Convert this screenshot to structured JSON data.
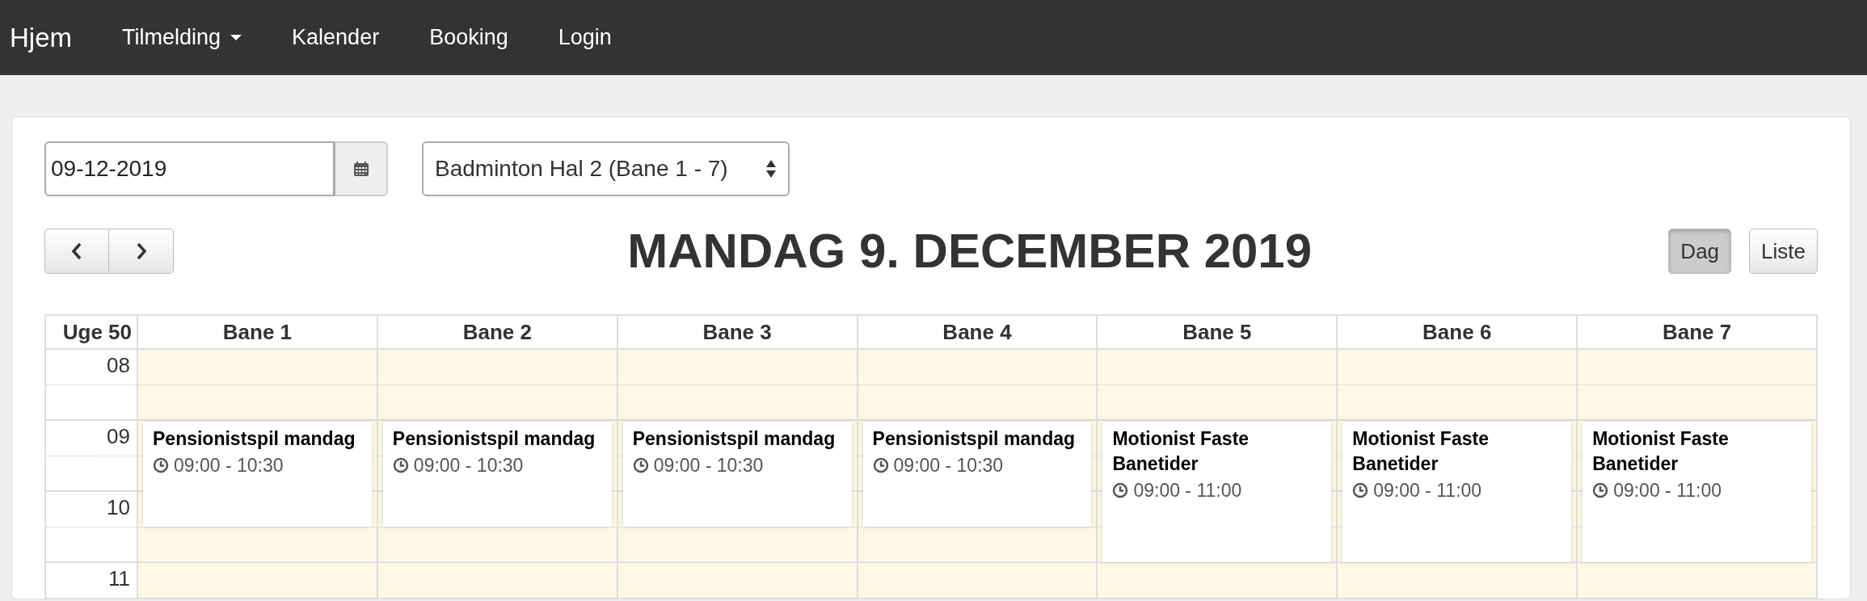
{
  "navbar": {
    "brand": "Hjem",
    "items": [
      {
        "label": "Tilmelding",
        "dropdown": true
      },
      {
        "label": "Kalender",
        "dropdown": false
      },
      {
        "label": "Booking",
        "dropdown": false
      },
      {
        "label": "Login",
        "dropdown": false
      }
    ]
  },
  "date_field": {
    "value": "09-12-2019"
  },
  "hall_select": {
    "value": "Badminton Hal 2 (Bane 1 - 7)"
  },
  "calendar": {
    "title": "MANDAG 9. DECEMBER 2019",
    "views": [
      {
        "label": "Dag",
        "selected": true
      },
      {
        "label": "Liste",
        "selected": false
      }
    ],
    "week_label": "Uge 50",
    "hours": [
      "08",
      "09",
      "10",
      "11"
    ],
    "lanes": [
      {
        "name": "Bane 1",
        "events": [
          {
            "title": "Pensionistspil mandag",
            "time": "09:00 - 10:30"
          }
        ]
      },
      {
        "name": "Bane 2",
        "events": [
          {
            "title": "Pensionistspil mandag",
            "time": "09:00 - 10:30"
          }
        ]
      },
      {
        "name": "Bane 3",
        "events": [
          {
            "title": "Pensionistspil mandag",
            "time": "09:00 - 10:30"
          }
        ]
      },
      {
        "name": "Bane 4",
        "events": [
          {
            "title": "Pensionistspil mandag",
            "time": "09:00 - 10:30"
          }
        ]
      },
      {
        "name": "Bane 5",
        "events": [
          {
            "title": "Motionist Faste Banetider",
            "time": "09:00 - 11:00"
          }
        ]
      },
      {
        "name": "Bane 6",
        "events": [
          {
            "title": "Motionist Faste Banetider",
            "time": "09:00 - 11:00"
          }
        ]
      },
      {
        "name": "Bane 7",
        "events": [
          {
            "title": "Motionist Faste Banetider",
            "time": "09:00 - 11:00"
          }
        ]
      }
    ]
  }
}
